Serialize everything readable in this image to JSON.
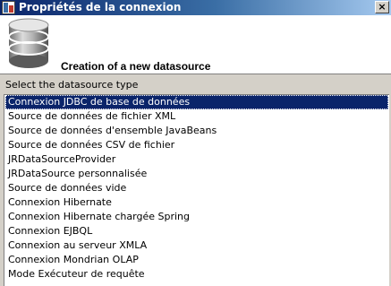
{
  "window": {
    "title": "Propriétés de la connexion",
    "close_label": "×"
  },
  "header": {
    "title": "Creation of a new datasource",
    "icon": "database-icon"
  },
  "section": {
    "label": "Select the datasource type"
  },
  "datasource_types": {
    "selected_index": 0,
    "items": [
      "Connexion JDBC de base de données",
      "Source de données de fichier XML",
      "Source de données d'ensemble JavaBeans",
      "Source de données CSV de fichier",
      "JRDataSourceProvider",
      "JRDataSource personnalisée",
      "Source de données vide",
      "Connexion Hibernate",
      "Connexion Hibernate chargée Spring",
      "Connexion EJBQL",
      "Connexion au serveur XMLA",
      "Connexion Mondrian OLAP",
      "Mode Exécuteur de requête"
    ]
  },
  "colors": {
    "title_bar": "#0a246a",
    "selection": "#0a246a",
    "dialog_bg": "#d4d0c8"
  }
}
